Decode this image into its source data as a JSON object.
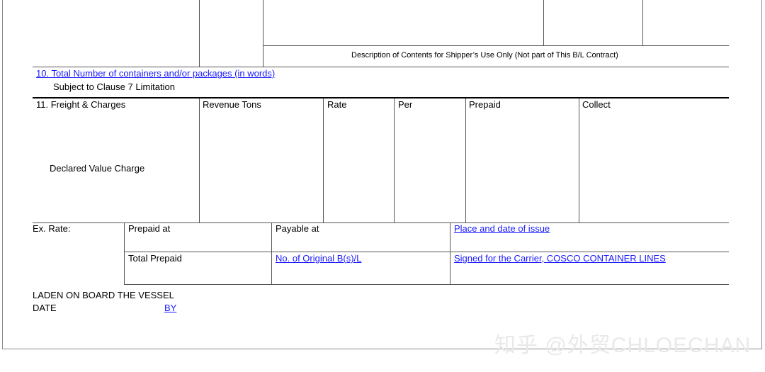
{
  "description_note": "Description of Contents for Shipper’s Use Only (Not part of This B/L Contract)",
  "total_containers": {
    "label": "10. Total Number of containers and/or packages (in words)",
    "subtext": "Subject to Clause 7 Limitation"
  },
  "freight": {
    "headers": [
      "11. Freight & Charges",
      "Revenue Tons",
      "Rate",
      "Per",
      "Prepaid",
      "Collect"
    ],
    "declared_value": "Declared Value Charge"
  },
  "footer": {
    "ex_rate": "Ex. Rate:",
    "prepaid_at": "Prepaid at",
    "payable_at": "Payable at",
    "place_date_issue": "Place and date of issue",
    "total_prepaid": "Total Prepaid",
    "original_bl": "No. of Original B(s)/L",
    "signed_for": "Signed for the Carrier, COSCO CONTAINER LINES"
  },
  "laden": {
    "line1": "LADEN ON BOARD THE VESSEL",
    "date": "DATE",
    "by": "BY"
  },
  "watermark": "知乎 @外贸CHLOECHAN"
}
